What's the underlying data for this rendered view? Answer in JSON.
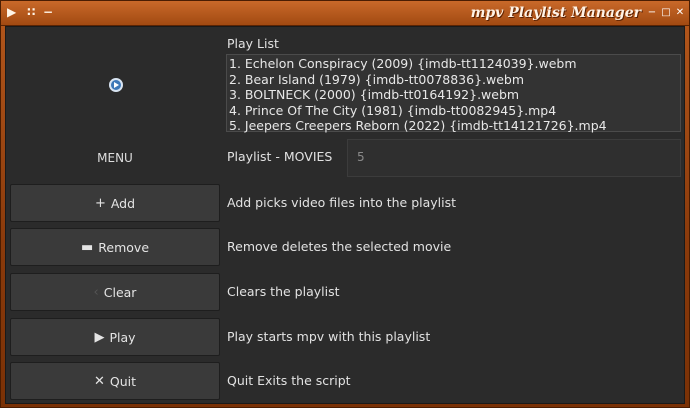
{
  "window": {
    "title": "mpv Playlist Manager",
    "left_icons": [
      "▶",
      "∷",
      "−"
    ],
    "controls": [
      "−",
      "□",
      "✕"
    ]
  },
  "playlist": {
    "label": "Play List",
    "items": [
      "1. Echelon Conspiracy (2009) {imdb-tt1124039}.webm",
      "2. Bear Island (1979) {imdb-tt0078836}.webm",
      "3. BOLTNECK (2000) {imdb-tt0164192}.webm",
      "4. Prince Of The City (1981) {imdb-tt0082945}.mp4",
      "5. Jeepers Creepers Reborn (2022) {imdb-tt14121726}.mp4"
    ],
    "name_label": "Playlist - MOVIES",
    "count": "5"
  },
  "menu": {
    "label": "MENU",
    "buttons": [
      {
        "icon": "+",
        "label": "Add",
        "desc": "Add picks video files into the playlist"
      },
      {
        "icon": "▬",
        "label": "Remove",
        "desc": "Remove deletes the selected movie"
      },
      {
        "icon": "‹",
        "label": "Clear",
        "desc": "Clears the playlist"
      },
      {
        "icon": "▶",
        "label": "Play",
        "desc": "Play starts mpv with this playlist"
      },
      {
        "icon": "✕",
        "label": "Quit",
        "desc": "Quit Exits the script"
      }
    ]
  },
  "icons": {
    "logo": "mpv-logo-icon"
  }
}
